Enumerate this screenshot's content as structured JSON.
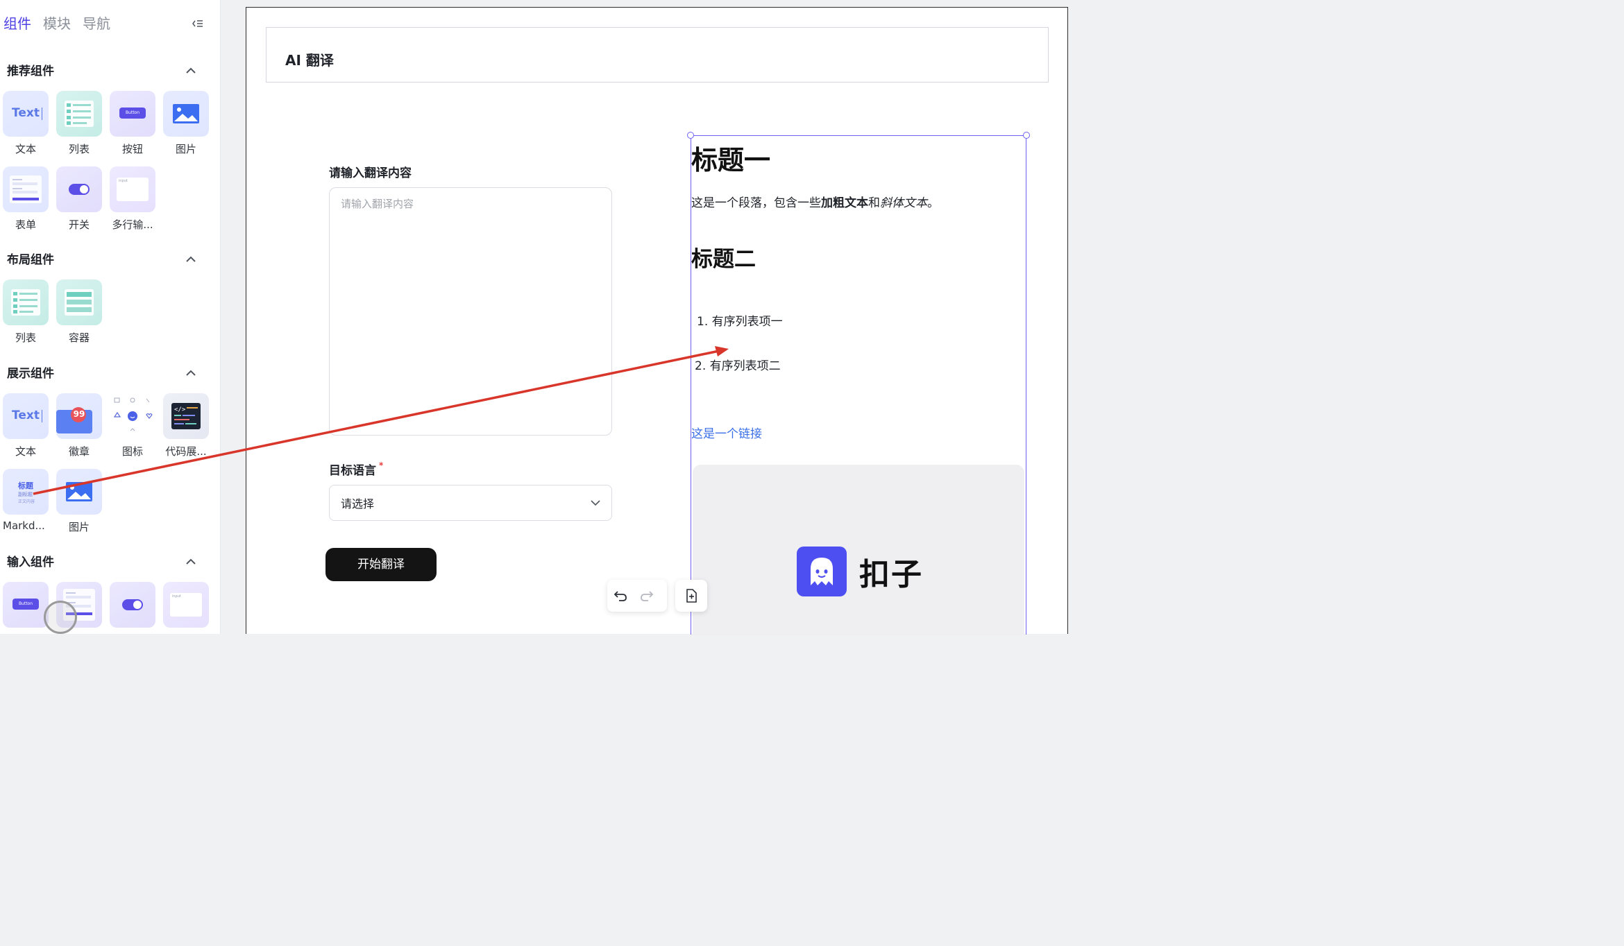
{
  "sidebar": {
    "tabs": [
      "组件",
      "模块",
      "导航"
    ],
    "active_tab": "组件",
    "sections": {
      "recommended": {
        "title": "推荐组件",
        "items": [
          "文本",
          "列表",
          "按钮",
          "图片",
          "表单",
          "开关",
          "多行输..."
        ]
      },
      "layout": {
        "title": "布局组件",
        "items": [
          "列表",
          "容器"
        ]
      },
      "display": {
        "title": "展示组件",
        "items": [
          "文本",
          "徽章",
          "图标",
          "代码展...",
          "Markd...",
          "图片"
        ]
      },
      "input": {
        "title": "输入组件"
      }
    },
    "thumb_text": "Text",
    "thumb_button": "Button",
    "thumb_input": "input",
    "badge_count": "99",
    "markdown_thumb": [
      "标题",
      "副标题",
      "正文内容"
    ]
  },
  "canvas": {
    "app_title": "AI 翻译",
    "input_label": "请输入翻译内容",
    "input_placeholder": "请输入翻译内容",
    "lang_label": "目标语言",
    "lang_required": "*",
    "lang_value": "请选择",
    "start_button": "开始翻译"
  },
  "markdown": {
    "h1": "标题一",
    "p_pre": "这是一个段落，包含一些",
    "p_bold": "加粗文本",
    "p_mid": "和",
    "p_italic": "斜体文本",
    "p_end": "。",
    "h2": "标题二",
    "li1": "1. 有序列表项一",
    "li2": "2. 有序列表项二",
    "link": "这是一个链接",
    "logo_text": "扣子"
  },
  "colors": {
    "accent": "#4e40e5",
    "selection": "#6d5ff0",
    "arrow": "#d9362b",
    "button_bg": "#141414",
    "link": "#3a6fe8"
  },
  "icons": [
    "collapse-panel-icon",
    "chevron-up-icon",
    "undo-icon",
    "redo-icon",
    "add-page-icon",
    "chevron-down-icon"
  ]
}
